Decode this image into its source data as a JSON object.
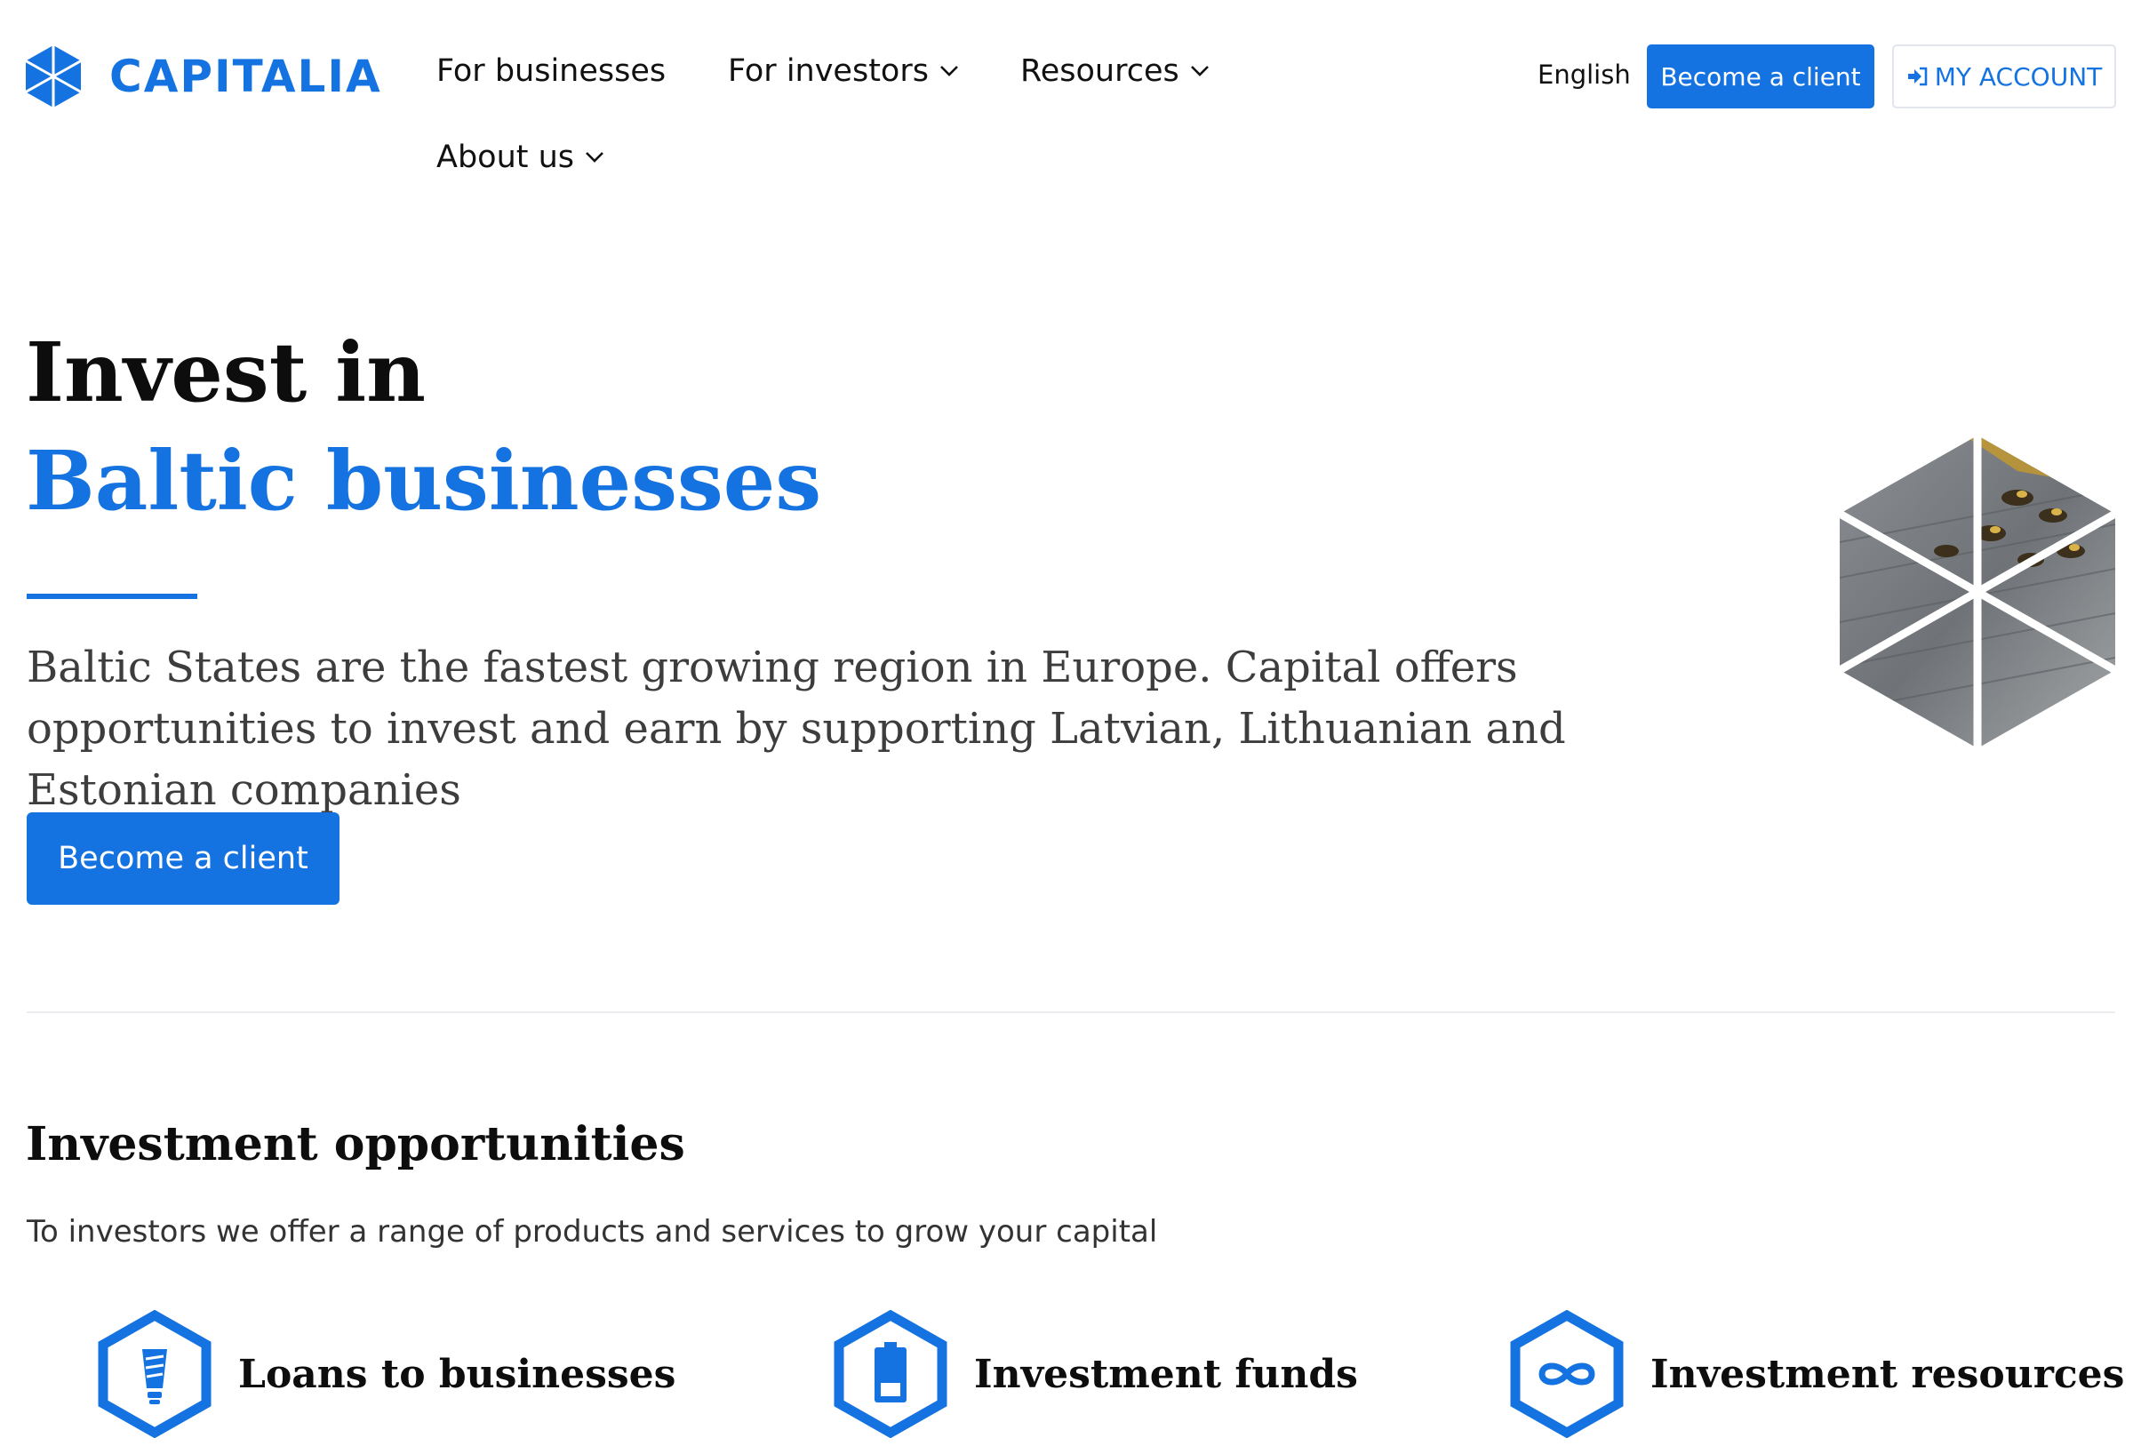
{
  "header": {
    "logo_text": "CAPITALIA",
    "nav": {
      "businesses": "For businesses",
      "investors": "For investors",
      "resources": "Resources",
      "about": "About us"
    },
    "language": "English",
    "become_client": "Become a client",
    "my_account": "MY ACCOUNT"
  },
  "hero": {
    "title_line1": "Invest in",
    "title_line2": "Baltic businesses",
    "description": "Baltic States are the fastest growing region in Europe. Capital offers opportunities to invest and earn by supporting Latvian, Lithuanian and Estonian companies",
    "cta": "Become a client"
  },
  "opportunities": {
    "title": "Investment opportunities",
    "subtitle": "To investors we offer a range of products and services to grow your capital",
    "items": [
      {
        "label": "Loans to businesses",
        "icon": "lightbulb-icon"
      },
      {
        "label": "Investment funds",
        "icon": "battery-icon"
      },
      {
        "label": "Investment resources",
        "icon": "infinity-icon"
      }
    ]
  },
  "colors": {
    "accent": "#1573e1",
    "text": "#0d0d0d",
    "muted": "#3d3d3d"
  }
}
